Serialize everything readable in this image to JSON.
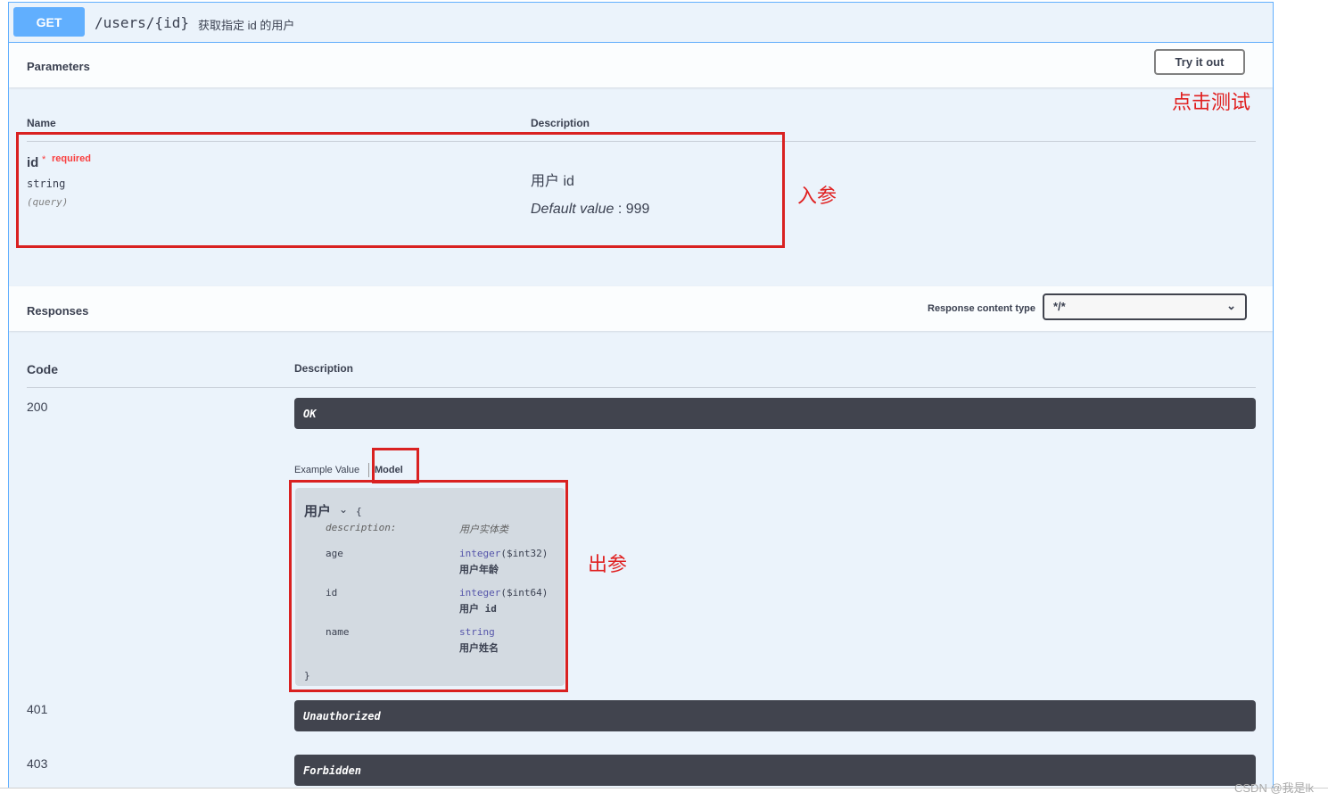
{
  "operation": {
    "method": "GET",
    "path": "/users/{id}",
    "summary": "获取指定 id 的用户"
  },
  "parameters": {
    "title": "Parameters",
    "try_label": "Try it out",
    "col_name": "Name",
    "col_desc": "Description",
    "items": [
      {
        "name": "id",
        "required_star": "*",
        "required_label": "required",
        "type": "string",
        "in": "(query)",
        "description": "用户 id",
        "default_label": "Default value",
        "default_sep": " : ",
        "default_value": "999"
      }
    ]
  },
  "responses": {
    "title": "Responses",
    "content_type_label": "Response content type",
    "content_type_value": "*/*",
    "col_code": "Code",
    "col_desc": "Description",
    "items": [
      {
        "code": "200",
        "description": "OK"
      },
      {
        "code": "401",
        "description": "Unauthorized"
      },
      {
        "code": "403",
        "description": "Forbidden"
      }
    ],
    "tabs": {
      "example": "Example Value",
      "model": "Model"
    },
    "model": {
      "title": "用户",
      "open_brace": "{",
      "close_brace": "}",
      "description_key": "description:",
      "description_val": "用户实体类",
      "props": [
        {
          "name": "age",
          "type": "integer",
          "format": "($int32)",
          "desc": "用户年龄"
        },
        {
          "name": "id",
          "type": "integer",
          "format": "($int64)",
          "desc": "用户 id"
        },
        {
          "name": "name",
          "type": "string",
          "format": "",
          "desc": "用户姓名"
        }
      ]
    }
  },
  "annotations": {
    "click_test": "点击测试",
    "input_params": "入参",
    "output_params": "出参"
  },
  "watermark": "CSDN @我是lk",
  "colors": {
    "get_blue": "#61affe",
    "dark_bar": "#41444e",
    "annotation_red": "#d92121"
  }
}
